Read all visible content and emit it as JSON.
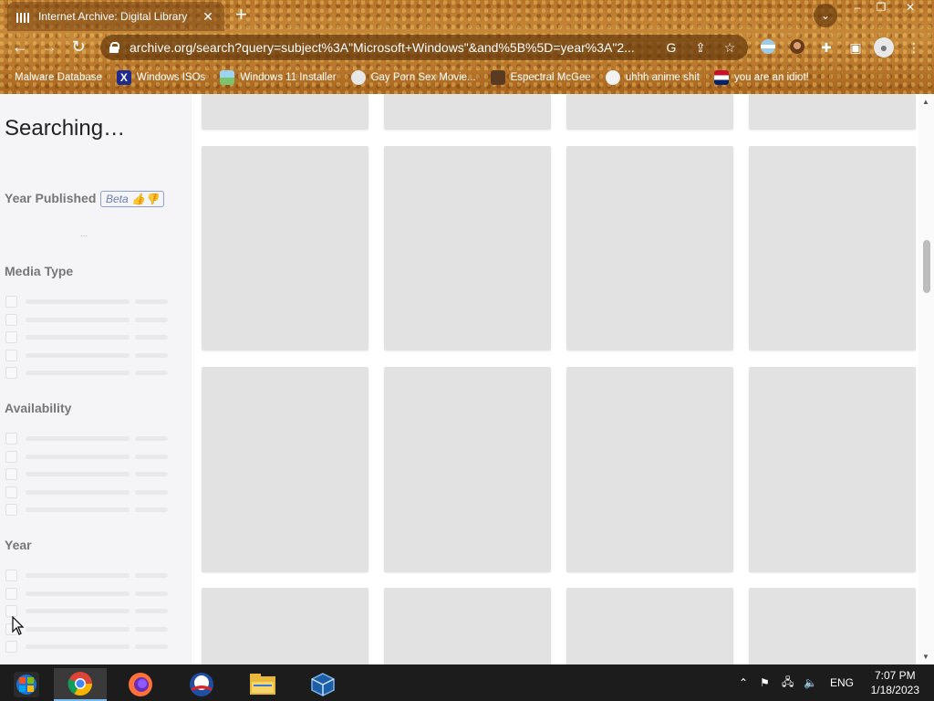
{
  "browser": {
    "tab_title": "Internet Archive: Digital Library",
    "tab_close": "✕",
    "new_tab": "+",
    "tab_search_icon": "chevron-down",
    "window_controls": [
      "–",
      "❐",
      "✕"
    ],
    "url": "archive.org/search?query=subject%3A\"Microsoft+Windows\"&and%5B%5D=year%3A\"2...",
    "bookmarks": [
      {
        "label": "Malware Database",
        "icon": "none"
      },
      {
        "label": "Windows ISOs",
        "icon": "x-logo"
      },
      {
        "label": "Windows 11 Installer",
        "icon": "image"
      },
      {
        "label": "Gay Porn Sex Movie...",
        "icon": "smiley"
      },
      {
        "label": "Espectral McGee",
        "icon": "character"
      },
      {
        "label": "uhhh anime shit",
        "icon": "anime"
      },
      {
        "label": "you are an idiot!",
        "icon": "flag"
      }
    ]
  },
  "page": {
    "status_title": "Searching…",
    "facets": [
      {
        "title": "Year Published",
        "badge": "Beta 👍👎",
        "loading": "..."
      },
      {
        "title": "Media Type"
      },
      {
        "title": "Availability"
      },
      {
        "title": "Year"
      }
    ]
  },
  "taskbar": {
    "apps": [
      "windows-logo",
      "chrome",
      "firefox",
      "obama-logo",
      "file-explorer",
      "virtualbox"
    ],
    "language": "ENG",
    "time": "7:07 PM",
    "date": "1/18/2023"
  },
  "colors": {
    "skeleton": "#e2e2e2",
    "sidebar_bg": "#f5f5f7",
    "taskbar_bg": "#1c1c1c"
  }
}
